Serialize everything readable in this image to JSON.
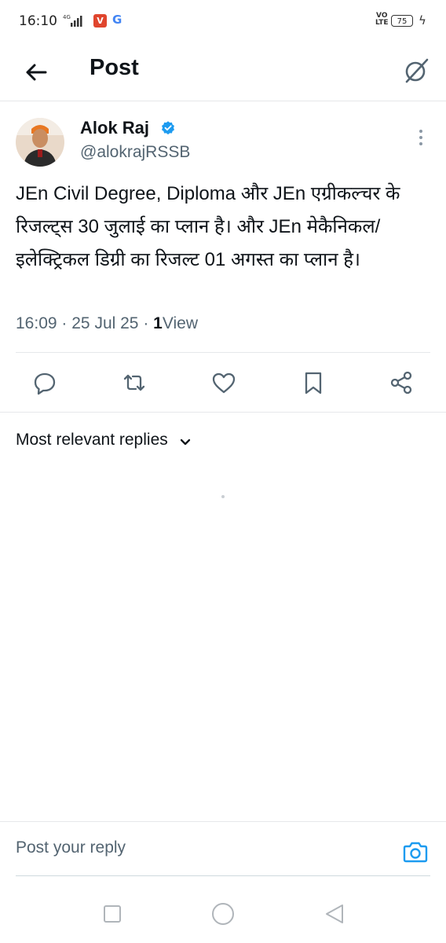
{
  "status_bar": {
    "time": "16:10",
    "signal_label": "4G",
    "volte": "VO LTE",
    "battery": "75",
    "app_icons": [
      "vivaldi-icon",
      "google-icon"
    ]
  },
  "header": {
    "title": "Post",
    "back_icon": "arrow-left-icon",
    "grok_icon": "grok-icon"
  },
  "tweet": {
    "author_name": "Alok Raj",
    "author_handle": "@alokrajRSSB",
    "verified": true,
    "text": "JEn Civil Degree, Diploma और JEn एग्रीकल्चर के रिजल्ट्स 30 जुलाई का प्लान है। और JEn मेकैनिकल/ इलेक्ट्रिकल डिग्री का रिजल्ट 01 अगस्त का प्लान है।",
    "time": "16:09",
    "date": "25 Jul 25",
    "views_count": "1",
    "views_label": "View"
  },
  "actions": [
    "reply-icon",
    "retweet-icon",
    "like-icon",
    "bookmark-icon",
    "share-icon"
  ],
  "replies": {
    "sort_label": "Most relevant replies"
  },
  "reply_composer": {
    "placeholder": "Post your reply"
  },
  "colors": {
    "accent": "#1d9bf0",
    "text_primary": "#0f1419",
    "text_secondary": "#536471"
  }
}
